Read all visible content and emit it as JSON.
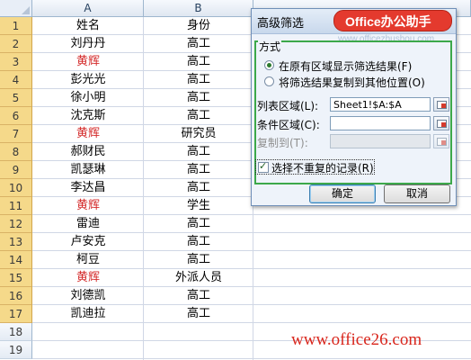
{
  "columns": [
    "A",
    "B"
  ],
  "row_numbers": [
    "1",
    "2",
    "3",
    "4",
    "5",
    "6",
    "7",
    "8",
    "9",
    "10",
    "11",
    "12",
    "13",
    "14",
    "15",
    "16",
    "17",
    "18",
    "19"
  ],
  "rows": [
    {
      "name": "姓名",
      "role": "身份",
      "highlight": false
    },
    {
      "name": "刘丹丹",
      "role": "高工",
      "highlight": false
    },
    {
      "name": "黄辉",
      "role": "高工",
      "highlight": true
    },
    {
      "name": "彭光光",
      "role": "高工",
      "highlight": false
    },
    {
      "name": "徐小明",
      "role": "高工",
      "highlight": false
    },
    {
      "name": "沈克斯",
      "role": "高工",
      "highlight": false
    },
    {
      "name": "黄辉",
      "role": "研究员",
      "highlight": true
    },
    {
      "name": "郝财民",
      "role": "高工",
      "highlight": false
    },
    {
      "name": "凯瑟琳",
      "role": "高工",
      "highlight": false
    },
    {
      "name": "李达昌",
      "role": "高工",
      "highlight": false
    },
    {
      "name": "黄辉",
      "role": "学生",
      "highlight": true
    },
    {
      "name": "雷迪",
      "role": "高工",
      "highlight": false
    },
    {
      "name": "卢安克",
      "role": "高工",
      "highlight": false
    },
    {
      "name": "柯豆",
      "role": "高工",
      "highlight": false
    },
    {
      "name": "黄辉",
      "role": "外派人员",
      "highlight": true
    },
    {
      "name": "刘德凯",
      "role": "高工",
      "highlight": false
    },
    {
      "name": "凯迪拉",
      "role": "高工",
      "highlight": false
    }
  ],
  "dialog": {
    "title": "高级筛选",
    "method_label": "方式",
    "radio_in_place": "在原有区域显示筛选结果(F)",
    "radio_copy": "将筛选结果复制到其他位置(O)",
    "list_range_label": "列表区域(L):",
    "list_range_value": "Sheet1!$A:$A",
    "criteria_range_label": "条件区域(C):",
    "criteria_range_value": "",
    "copy_to_label": "复制到(T):",
    "copy_to_value": "",
    "unique_label": "选择不重复的记录(R)",
    "unique_checked": true,
    "ok_label": "确定",
    "cancel_label": "取消"
  },
  "watermarks": {
    "badge": "Office办公助手",
    "badge_url": "www.officezhushou.com",
    "bottom": "www.office26.com"
  },
  "colors": {
    "highlight_text": "#d42b2b",
    "row_header_selected": "#f5d98a",
    "group_border": "#3ca84a",
    "badge": "#e43a2e"
  }
}
